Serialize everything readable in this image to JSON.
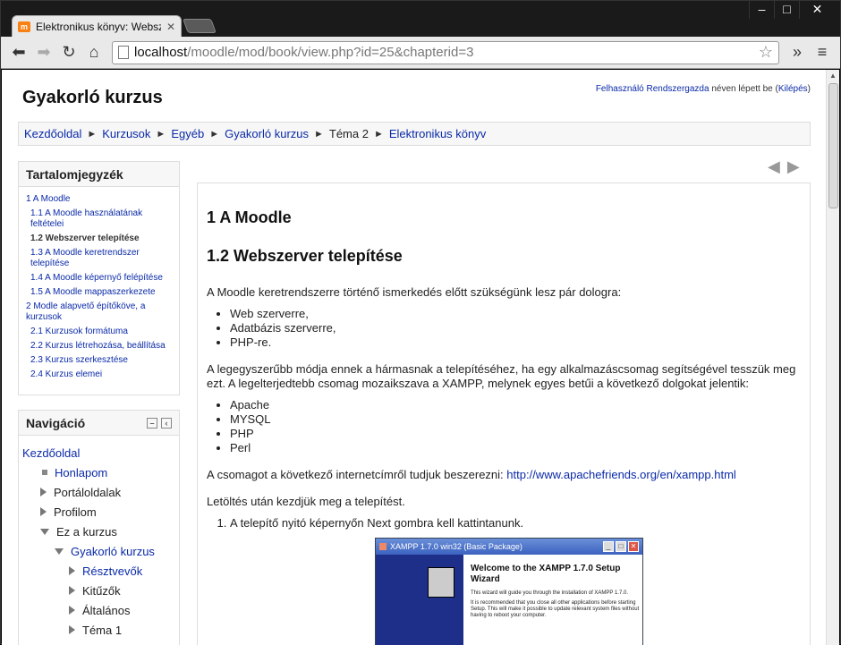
{
  "browser": {
    "tab_title": "Elektronikus könyv: Websz",
    "url_host": "localhost",
    "url_path": "/moodle/mod/book/view.php?id=25&chapterid=3"
  },
  "page": {
    "site_title": "Gyakorló kurzus",
    "login_user": "Felhasználó Rendszergazda",
    "login_text": " néven lépett be (",
    "logout": "Kilépés",
    "login_end": ")"
  },
  "breadcrumb": [
    "Kezdőoldal",
    "Kurzusok",
    "Egyéb",
    "Gyakorló kurzus",
    "Téma 2",
    "Elektronikus könyv"
  ],
  "toc": {
    "title": "Tartalomjegyzék",
    "items": [
      {
        "label": "1 A Moodle",
        "level": 1,
        "current": false
      },
      {
        "label": "1.1 A Moodle használatának feltételei",
        "level": 2,
        "current": false
      },
      {
        "label": "1.2 Webszerver telepítése",
        "level": 2,
        "current": true
      },
      {
        "label": "1.3 A Moodle keretrendszer telepítése",
        "level": 2,
        "current": false
      },
      {
        "label": "1.4 A Moodle képernyő felépítése",
        "level": 2,
        "current": false
      },
      {
        "label": "1.5 A Moodle mappaszerkezete",
        "level": 2,
        "current": false
      },
      {
        "label": "2 Modle alapvető építőköve, a kurzusok",
        "level": 1,
        "current": false
      },
      {
        "label": "2.1 Kurzusok formátuma",
        "level": 2,
        "current": false
      },
      {
        "label": "2.2 Kurzus létrehozása, beállítása",
        "level": 2,
        "current": false
      },
      {
        "label": "2.3 Kurzus szerkesztése",
        "level": 2,
        "current": false
      },
      {
        "label": "2.4 Kurzus elemei",
        "level": 2,
        "current": false
      }
    ]
  },
  "navigation": {
    "title": "Navigáció",
    "items": [
      {
        "label": "Kezdőoldal",
        "indent": 0,
        "marker": "none",
        "link": true
      },
      {
        "label": "Honlapom",
        "indent": 1,
        "marker": "square",
        "link": true
      },
      {
        "label": "Portáloldalak",
        "indent": 1,
        "marker": "right",
        "link": false
      },
      {
        "label": "Profilom",
        "indent": 1,
        "marker": "right",
        "link": false
      },
      {
        "label": "Ez a kurzus",
        "indent": 1,
        "marker": "down",
        "link": false
      },
      {
        "label": "Gyakorló kurzus",
        "indent": 2,
        "marker": "down",
        "link": true
      },
      {
        "label": "Résztvevők",
        "indent": 3,
        "marker": "right",
        "link": true
      },
      {
        "label": "Kitűzők",
        "indent": 3,
        "marker": "right",
        "link": false
      },
      {
        "label": "Általános",
        "indent": 3,
        "marker": "right",
        "link": false
      },
      {
        "label": "Téma 1",
        "indent": 3,
        "marker": "right",
        "link": false
      }
    ]
  },
  "chapter": {
    "h1": "1 A Moodle",
    "h2": "1.2 Webszerver telepítése",
    "p1": "A Moodle keretrendszerre történő ismerkedés előtt szükségünk lesz pár dologra:",
    "list1": [
      "Web szerverre,",
      "Adatbázis szerverre,",
      "PHP-re."
    ],
    "p2": "A legegyszerűbb módja ennek a hármasnak a telepítéséhez, ha egy alkalmazáscsomag segítségével tesszük meg ezt. A legelterjedtebb csomag mozaikszava a XAMPP, melynek egyes betűi a következő dolgokat jelentik:",
    "list2": [
      "Apache",
      "MYSQL",
      "PHP",
      "Perl"
    ],
    "p3_text": "A csomagot a következő internetcímről tudjuk beszerezni: ",
    "p3_link": "http://www.apachefriends.org/en/xampp.html",
    "p4": "Letöltés után kezdjük meg a telepítést.",
    "step1": "A telepítő nyitó képernyőn Next gombra kell kattintanunk."
  },
  "installer": {
    "title": "XAMPP 1.7.0 win32 (Basic Package)",
    "welcome": "Welcome to the XAMPP 1.7.0 Setup Wizard",
    "body1": "This wizard will guide you through the installation of XAMPP 1.7.0.",
    "body2": "It is recommended that you close all other applications before starting Setup. This will make it possible to update relevant system files without having to reboot your computer."
  }
}
